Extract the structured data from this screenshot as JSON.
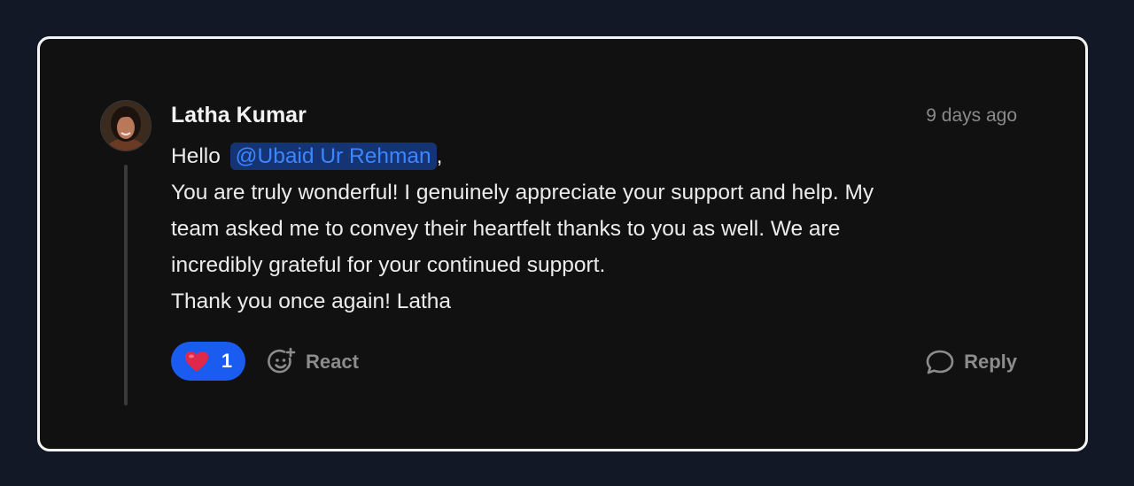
{
  "comment": {
    "author": "Latha Kumar",
    "timestamp": "9 days ago",
    "greeting": "Hello",
    "mention": "@Ubaid Ur Rehman",
    "greeting_suffix": ",",
    "lines": [
      "You are truly wonderful! I genuinely appreciate your support and help. My",
      "team asked me to convey their heartfelt thanks to you as well. We are",
      "incredibly grateful for your continued support.",
      "Thank you once again! Latha"
    ]
  },
  "actions": {
    "reaction_icon": "heart-icon",
    "reaction_count": "1",
    "react_icon": "smiley-plus-icon",
    "react_label": "React",
    "reply_icon": "speech-bubble-icon",
    "reply_label": "Reply"
  },
  "colors": {
    "background": "#121826",
    "card": "#111111",
    "mention_bg": "#143473",
    "mention_text": "#3d86ff",
    "reaction_pill": "#1a5cf0",
    "heart": "#e0284a"
  }
}
